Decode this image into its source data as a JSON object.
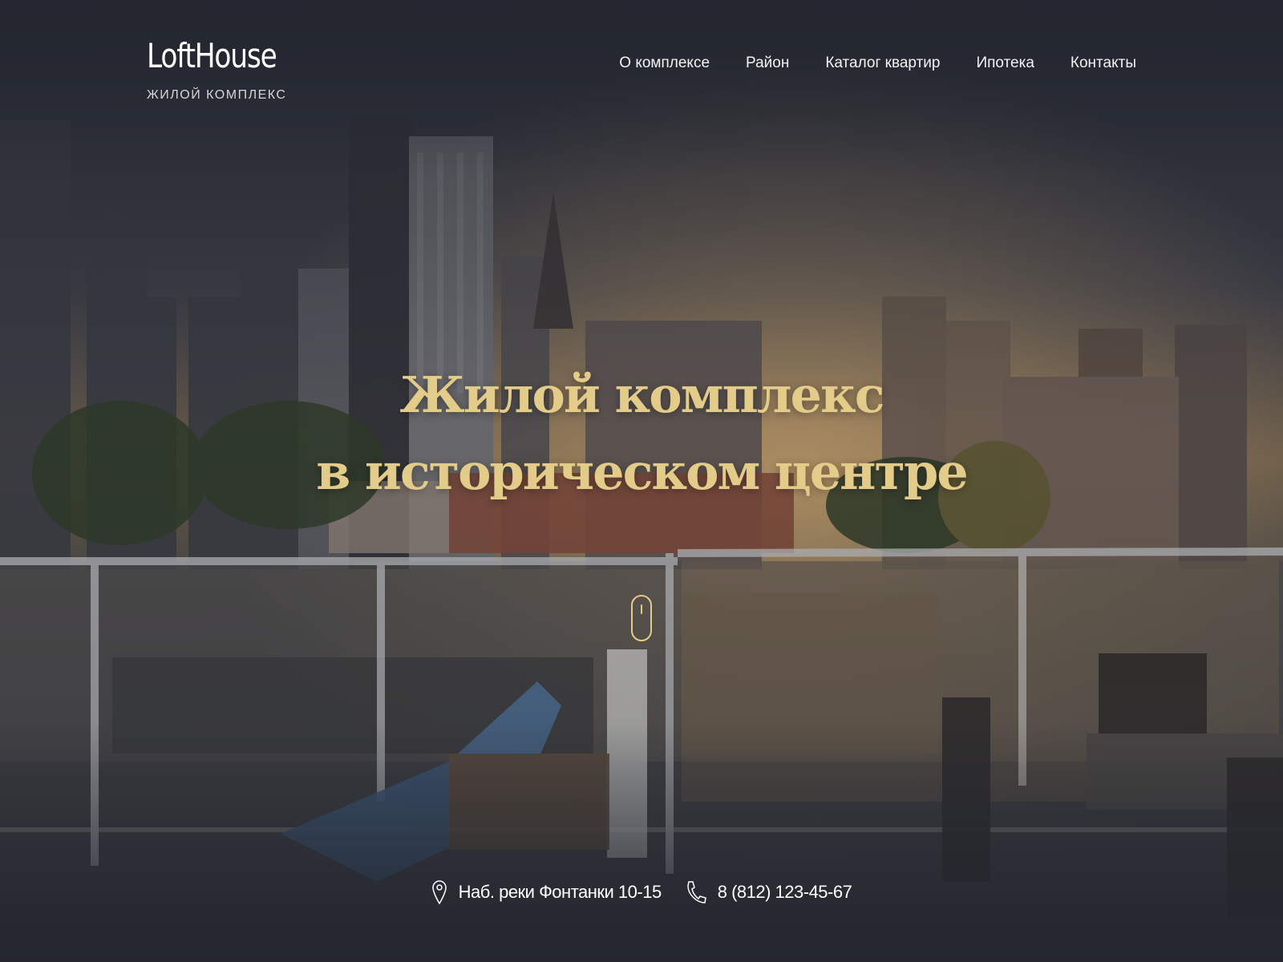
{
  "header": {
    "logo": "LoftHouse",
    "logo_subtitle": "ЖИЛОЙ КОМПЛЕКС"
  },
  "nav": {
    "items": [
      {
        "label": "О комплексе"
      },
      {
        "label": "Район"
      },
      {
        "label": "Каталог квартир"
      },
      {
        "label": "Ипотека"
      },
      {
        "label": "Контакты"
      }
    ]
  },
  "hero": {
    "title_line1": "Жилой комплекс",
    "title_line2": "в историческом центре"
  },
  "contacts": {
    "address": "Наб. реки Фонтанки 10-15",
    "phone": "8 (812) 123-45-67"
  },
  "icons": {
    "address": "map-pin-icon",
    "phone": "phone-icon",
    "scroll": "mouse-scroll-icon"
  },
  "colors": {
    "accent": "#e3cb8a",
    "background": "#23262f",
    "text": "#ffffff"
  }
}
